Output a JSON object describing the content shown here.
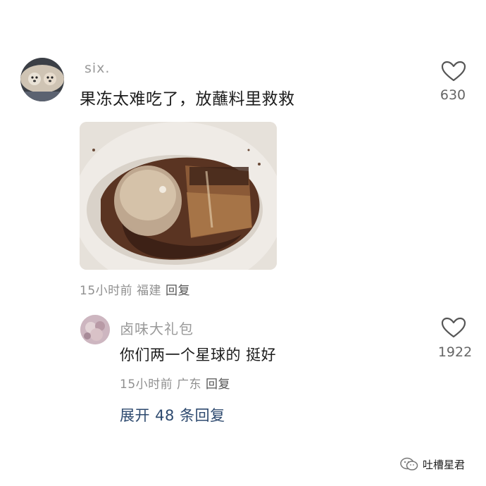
{
  "main_comment": {
    "username": "six.",
    "text": "果冻太难吃了，放蘸料里救救",
    "meta": {
      "time": "15小时前",
      "location": "福建",
      "reply_label": "回复"
    },
    "likes": "630",
    "avatar_icon": "dog-avatar"
  },
  "reply_comment": {
    "username": "卤味大礼包",
    "text": "你们两一个星球的 挺好",
    "meta": {
      "time": "15小时前",
      "location": "广东",
      "reply_label": "回复"
    },
    "likes": "1922"
  },
  "expand_replies": "展开 48 条回复",
  "watermark": "吐槽星君",
  "colors": {
    "expand_link": "#2e4a6f",
    "meta_text": "#8f8f8f",
    "username": "#9a9a9a"
  }
}
